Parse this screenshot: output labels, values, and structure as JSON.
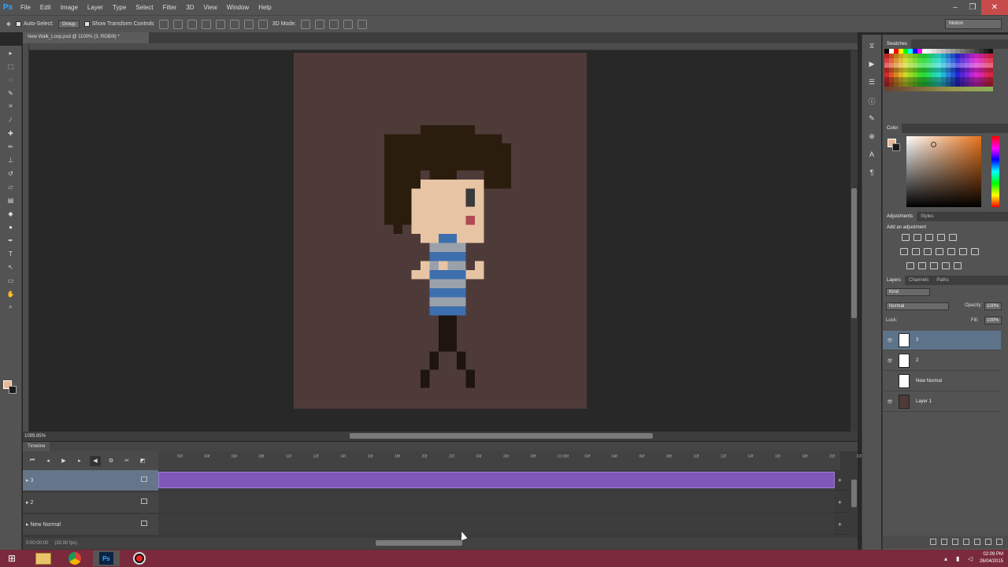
{
  "app": {
    "logo": "Ps"
  },
  "menu": [
    "File",
    "Edit",
    "Image",
    "Layer",
    "Type",
    "Select",
    "Filter",
    "3D",
    "View",
    "Window",
    "Help"
  ],
  "window_controls": {
    "min": "‒",
    "max": "❐",
    "close": "✕"
  },
  "options_bar": {
    "auto_select": "Auto-Select:",
    "auto_select_target": "Group",
    "show_transform": "Show Transform Controls",
    "mode_3d": "3D Mode:",
    "workspace": "Motion"
  },
  "document": {
    "tab_title": "New Walk_Loop.psd @ 1100% (3, RGB/8) *",
    "canvas_bg": "#4e3b39",
    "zoom": "1099.85%"
  },
  "timeline": {
    "tab": "Timeline",
    "current_time": "0:00:00:00",
    "fps": "(30.00 fps)",
    "ruler_ticks": [
      "02f",
      "04f",
      "06f",
      "08f",
      "10f",
      "12f",
      "14f",
      "16f",
      "18f",
      "20f",
      "22f",
      "24f",
      "26f",
      "28f",
      "01:00f",
      "02f",
      "04f",
      "06f",
      "08f",
      "10f",
      "12f",
      "14f",
      "16f",
      "18f",
      "20f",
      "22f"
    ],
    "tracks": [
      {
        "name": "3",
        "selected": true,
        "clip": true
      },
      {
        "name": "2",
        "selected": false,
        "clip": false
      },
      {
        "name": "New Normal",
        "selected": false,
        "clip": false
      }
    ]
  },
  "panels": {
    "swatches_tab": "Swatches",
    "color_tab": "Color",
    "adjustments_tab": "Adjustments",
    "styles_tab": "Styles",
    "adjustments_title": "Add an adjustment",
    "layers_tab": "Layers",
    "channels_tab": "Channels",
    "paths_tab": "Paths",
    "filter_kind": "Kind",
    "blend_mode": "Normal",
    "opacity_label": "Opacity:",
    "opacity": "100%",
    "lock_label": "Lock:",
    "fill_label": "Fill:",
    "fill": "100%",
    "fg_color": "#e7b996",
    "bg_color": "#1a1a1a"
  },
  "layers": [
    {
      "name": "3",
      "visible": true,
      "selected": true
    },
    {
      "name": "2",
      "visible": true,
      "selected": false
    },
    {
      "name": "New Normal",
      "visible": false,
      "selected": false
    },
    {
      "name": "Layer 1",
      "visible": true,
      "selected": false
    }
  ],
  "taskbar": {
    "time": "02:09 PM",
    "date": "26/04/2015"
  },
  "sprite_colors": {
    "hair": "#2a1d0e",
    "skin": "#e7c4a4",
    "eye": "#3a3a3a",
    "mouth": "#b04a55",
    "stripe_blue": "#3d6fae",
    "stripe_grey": "#9aa1ab",
    "leg": "#1e1410"
  }
}
